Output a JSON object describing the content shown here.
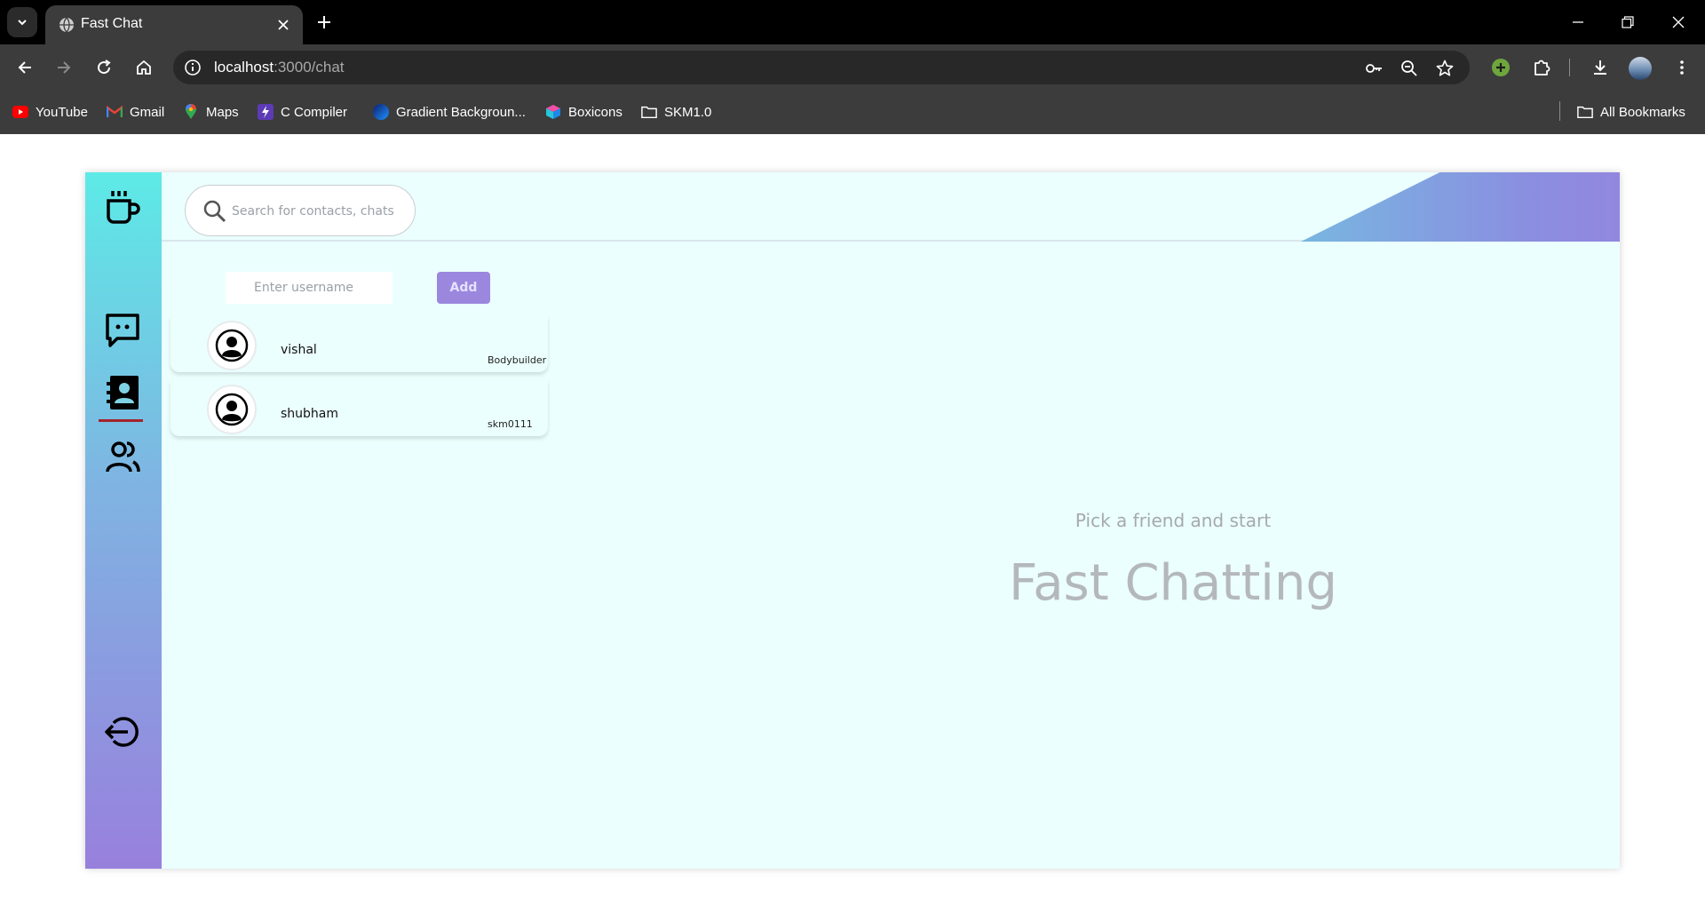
{
  "browser": {
    "tab_title": "Fast Chat",
    "url_host": "localhost",
    "url_rest": ":3000/chat",
    "bookmarks": [
      {
        "label": "YouTube",
        "icon": "youtube-icon"
      },
      {
        "label": "Gmail",
        "icon": "gmail-icon"
      },
      {
        "label": "Maps",
        "icon": "maps-icon"
      },
      {
        "label": "C Compiler",
        "icon": "compiler-icon"
      },
      {
        "label": "Gradient Backgroun...",
        "icon": "gradient-icon"
      },
      {
        "label": "Boxicons",
        "icon": "boxicons-icon"
      },
      {
        "label": "SKM1.0",
        "icon": "folder-icon"
      }
    ],
    "all_bookmarks_label": "All Bookmarks"
  },
  "app": {
    "search": {
      "placeholder": "Search for contacts, chats"
    },
    "add_contact": {
      "placeholder": "Enter username",
      "button_label": "Add"
    },
    "contacts": [
      {
        "name": "vishal",
        "status": "Bodybuilder"
      },
      {
        "name": "shubham",
        "status": "skm0111"
      }
    ],
    "empty_state": {
      "subtitle": "Pick a friend and start",
      "title": "Fast Chatting"
    },
    "colors": {
      "accent": "#9b87de",
      "sidebar_top": "#5deae6",
      "sidebar_bottom": "#9880dd",
      "background": "#ebfffe",
      "active_indicator": "#a3242a"
    }
  }
}
